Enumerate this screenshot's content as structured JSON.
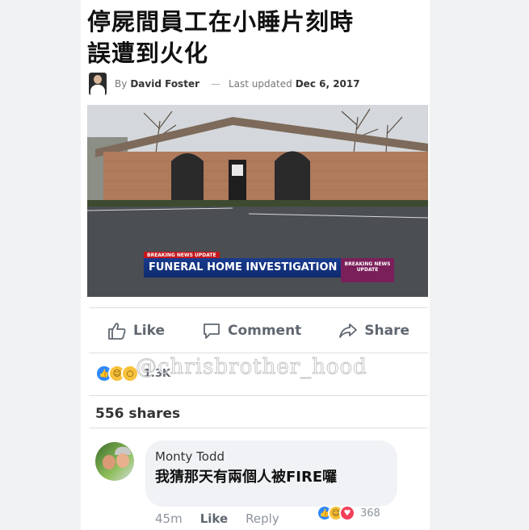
{
  "article": {
    "headline_line1": "停屍間員工在小睡片刻時",
    "headline_line2": "誤遭到火化",
    "byline_prefix": "By",
    "author": "David Foster",
    "updated_label": "Last updated",
    "updated_date": "Dec 6, 2017",
    "separator": "—"
  },
  "video": {
    "banner_top": "BREAKING NEWS UPDATE",
    "banner_main": "FUNERAL HOME INVESTIGATION",
    "banner_logo": "BREAKING NEWS UPDATE"
  },
  "actions": {
    "like": "Like",
    "comment": "Comment",
    "share": "Share"
  },
  "reactions": {
    "count": "1.3K",
    "icons": [
      "like-icon",
      "haha-icon",
      "wow-icon"
    ]
  },
  "watermark": "@chrisbrother_hood",
  "shares": "556 shares",
  "comment": {
    "name": "Monty Todd",
    "text": "我猜那天有兩個人被FIRE囉",
    "time": "45m",
    "like": "Like",
    "reply": "Reply",
    "reaction_count": "368",
    "reaction_icons": [
      "like-icon",
      "haha-icon",
      "love-icon"
    ]
  },
  "colors": {
    "facebook_blue": "#2d88ff",
    "text_gray": "#606770",
    "news_blue": "#1a3c8f",
    "news_red": "#c4161c"
  }
}
